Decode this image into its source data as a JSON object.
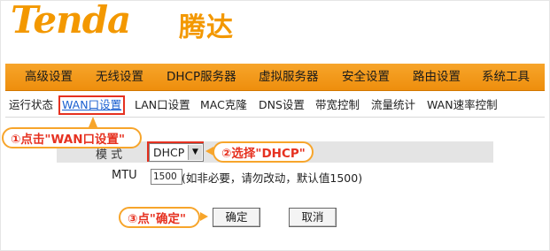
{
  "logo": {
    "brand_en": "Tenda",
    "brand_cn": "腾达",
    "color": "#f39800"
  },
  "topnav": {
    "items": [
      {
        "label": "高级设置"
      },
      {
        "label": "无线设置"
      },
      {
        "label": "DHCP服务器"
      },
      {
        "label": "虚拟服务器"
      },
      {
        "label": "安全设置"
      },
      {
        "label": "路由设置"
      },
      {
        "label": "系统工具"
      }
    ]
  },
  "subnav": {
    "items": [
      {
        "label": "运行状态"
      },
      {
        "label": "WAN口设置"
      },
      {
        "label": "LAN口设置"
      },
      {
        "label": "MAC克隆"
      },
      {
        "label": "DNS设置"
      },
      {
        "label": "带宽控制"
      },
      {
        "label": "流量统计"
      },
      {
        "label": "WAN速率控制"
      }
    ],
    "active": "WAN口设置"
  },
  "form": {
    "mode_label": "模 式",
    "mode_value": "DHCP",
    "mtu_label": "MTU",
    "mtu_value": "1500",
    "mtu_hint": "(如非必要，请勿改动，默认值1500)",
    "confirm_label": "确定",
    "cancel_label": "取消"
  },
  "callouts": {
    "step1": "①点击\"WAN口设置\"",
    "step2": "②选择\"DHCP\"",
    "step3": "③点\"确定\""
  },
  "colors": {
    "accent_orange": "#f7a52b",
    "highlight_red": "#e63120",
    "link_blue": "#1a5fd0"
  }
}
